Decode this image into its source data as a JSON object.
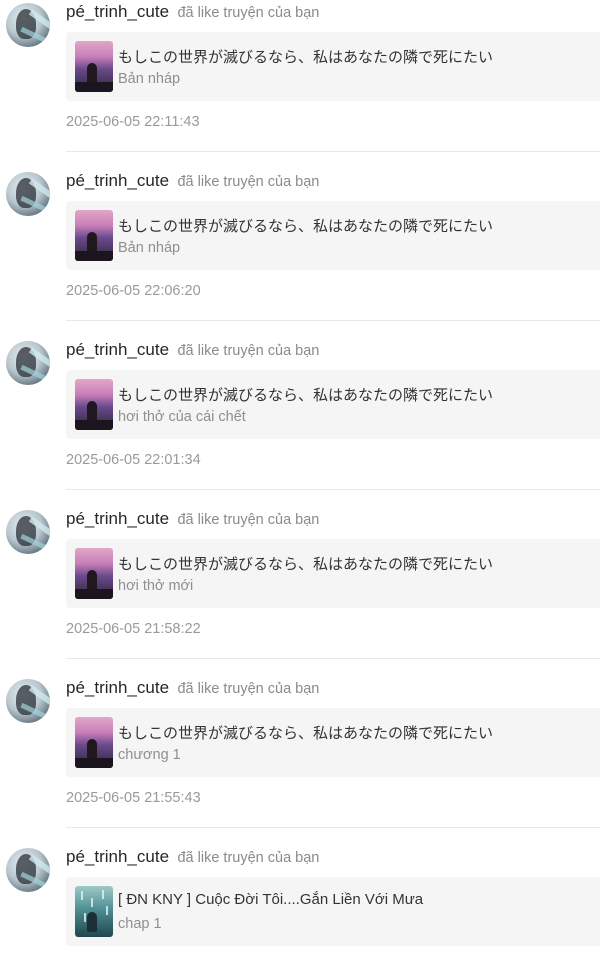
{
  "notifications": [
    {
      "username": "pé_trinh_cute",
      "action": "đã like truyện của bạn",
      "story_title": "もしこの世界が滅びるなら、私はあなたの隣で死にたい",
      "chapter": "Bản nháp",
      "timestamp": "2025-06-05 22:11:43",
      "cover": "sunset-girl-cover"
    },
    {
      "username": "pé_trinh_cute",
      "action": "đã like truyện của bạn",
      "story_title": "もしこの世界が滅びるなら、私はあなたの隣で死にたい",
      "chapter": "Bản nháp",
      "timestamp": "2025-06-05 22:06:20",
      "cover": "sunset-girl-cover"
    },
    {
      "username": "pé_trinh_cute",
      "action": "đã like truyện của bạn",
      "story_title": "もしこの世界が滅びるなら、私はあなたの隣で死にたい",
      "chapter": "hơi thở của cái chết",
      "timestamp": "2025-06-05 22:01:34",
      "cover": "sunset-girl-cover"
    },
    {
      "username": "pé_trinh_cute",
      "action": "đã like truyện của bạn",
      "story_title": "もしこの世界が滅びるなら、私はあなたの隣で死にたい",
      "chapter": "hơi thở mới",
      "timestamp": "2025-06-05 21:58:22",
      "cover": "sunset-girl-cover"
    },
    {
      "username": "pé_trinh_cute",
      "action": "đã like truyện của bạn",
      "story_title": "もしこの世界が滅びるなら、私はあなたの隣で死にたい",
      "chapter": "chương 1",
      "timestamp": "2025-06-05 21:55:43",
      "cover": "sunset-girl-cover"
    },
    {
      "username": "pé_trinh_cute",
      "action": "đã like truyện của bạn",
      "story_title": "[ ĐN KNY ] Cuộc Đời Tôi....Gắn Liền Với Mưa",
      "chapter": "chap 1",
      "timestamp": "",
      "cover": "rain-cover"
    }
  ],
  "colors": {
    "card_background": "#f5f5f5",
    "username": "#262626",
    "muted_text": "#8f8f8f",
    "divider": "#e8e8e8"
  }
}
